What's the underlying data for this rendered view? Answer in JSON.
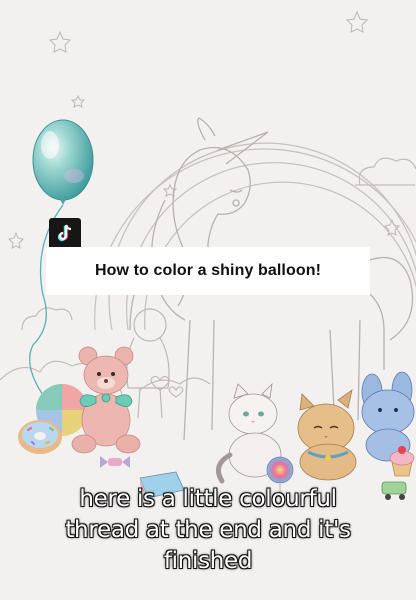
{
  "overlay": {
    "caption": "How to color a shiny balloon!",
    "subtitle_lines": [
      "here is a little colourful",
      "thread at the end and it's",
      "finished"
    ]
  },
  "icons": {
    "logo": "tiktok-logo-icon"
  },
  "colors": {
    "paper": "#f3f1f0",
    "balloon": "#6cc3c0",
    "bear": "#e9a9a6",
    "ribbon": "#5fc7b3",
    "bunny": "#8eb0da",
    "caption_bg": "#ffffff"
  }
}
